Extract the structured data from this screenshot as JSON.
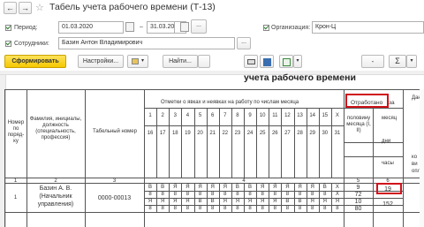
{
  "window": {
    "title": "Табель учета рабочего времени (Т-13)"
  },
  "filters": {
    "period_label": "Период:",
    "date_from": "01.03.2020",
    "date_sep": "–",
    "date_to": "31.03.2020",
    "period_btn": "...",
    "org_label": "Организация:",
    "org_value": "Крон-Ц",
    "employees_label": "Сотрудники:",
    "employees_value": "Базин Антон Владимирович"
  },
  "toolbar": {
    "generate": "Сформировать",
    "settings": "Настройки...",
    "find": "Найти...",
    "sigma": "Σ",
    "dash": "-"
  },
  "report": {
    "title": "учета  рабочего  времени",
    "headers": {
      "num": "Номер по поряд-ку",
      "name": "Фамилия, инициалы, должность (специальность, профессия)",
      "tab": "Табельный номер",
      "marks": "Отметки о явках и неявках на работу по числам месяца",
      "worked": "Отработано",
      "worked_suffix": "за",
      "half_month": "половину месяца (I, II)",
      "month": "месяц",
      "days": "дни",
      "hours": "часы",
      "right_cut": "Дан",
      "right_cut2": "ко",
      "right_cut3": "ви",
      "right_cut4": "опл"
    },
    "days_row1": [
      "1",
      "2",
      "3",
      "4",
      "5",
      "6",
      "7",
      "8",
      "9",
      "10",
      "11",
      "12",
      "13",
      "14",
      "15",
      "X"
    ],
    "days_row2": [
      "16",
      "17",
      "18",
      "19",
      "20",
      "21",
      "22",
      "23",
      "24",
      "25",
      "26",
      "27",
      "28",
      "29",
      "30",
      "31"
    ],
    "col_numbers": {
      "c1": "1",
      "c2": "2",
      "c3": "3",
      "c4": "4",
      "c5": "5",
      "c6": "6"
    },
    "row": {
      "num": "1",
      "name1": "Базин А. В.",
      "name2": "(Начальник",
      "name3": "управления)",
      "tab": "0000-00013",
      "marks_r1": [
        "В",
        "В",
        "Я",
        "Я",
        "Я",
        "Я",
        "Я",
        "В",
        "В",
        "Я",
        "Я",
        "Я",
        "Я",
        "Я",
        "В",
        "X"
      ],
      "marks_r2": [
        "8",
        "8",
        "8",
        "8",
        "8",
        "8",
        "8",
        "8",
        "8",
        "8",
        "8",
        "8",
        "8",
        "8",
        "8",
        "X"
      ],
      "marks_r3": [
        "Я",
        "Я",
        "Я",
        "Я",
        "В",
        "В",
        "Я",
        "Я",
        "Я",
        "Я",
        "Я",
        "В",
        "В",
        "Я",
        "Я",
        "Я"
      ],
      "marks_r4": [
        "8",
        "8",
        "8",
        "8",
        "8",
        "8",
        "8",
        "8",
        "8",
        "8",
        "8",
        "8",
        "8",
        "8",
        "8",
        "8"
      ],
      "half_values": [
        "9",
        "72",
        "10",
        "80"
      ],
      "month_days": "19",
      "month_hours": "152"
    }
  }
}
